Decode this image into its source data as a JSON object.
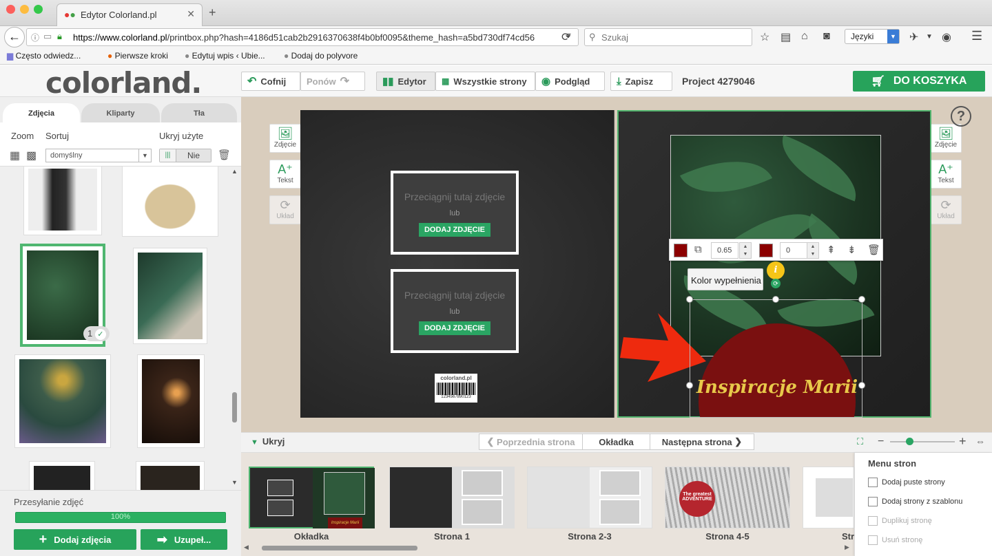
{
  "browser": {
    "tab_title": "Edytor Colorland.pl",
    "url_host": "https://www.colorland.pl",
    "url_path": "/printbox.php?hash=4186d51cab2b2916370638f4b0bf0095&theme_hash=a5bd730df74cd56",
    "search_placeholder": "Szukaj",
    "language": "Języki",
    "bookmarks": [
      "Często odwiedz...",
      "Pierwsze kroki",
      "Edytuj wpis ‹ Ubie...",
      "Dodaj do polyvore"
    ]
  },
  "app": {
    "logo": "colorland.",
    "undo": "Cofnij",
    "redo": "Ponów",
    "editor": "Edytor",
    "all_pages": "Wszystkie strony",
    "preview": "Podgląd",
    "save": "Zapisz",
    "project": "Project 4279046",
    "cart": "DO KOSZYKA"
  },
  "left": {
    "tabs": [
      "Zdjęcia",
      "Kliparty",
      "Tła"
    ],
    "zoom": "Zoom",
    "sort": "Sortuj",
    "hide_used": "Ukryj użyte",
    "sort_value": "domyślny",
    "hide_value": "Nie",
    "used_count": "1",
    "upload_label": "Przesyłanie zdjęć",
    "progress": "100%",
    "progress_value": 1.0,
    "add_photos": "Dodaj zdjęcia",
    "fill": "Uzupeł..."
  },
  "canvas": {
    "side_photos": "Zdjęcie",
    "side_text": "Tekst",
    "side_layout": "Układ",
    "drop_hint": "Przeciągnij tutaj zdjęcie",
    "drop_or": "lub",
    "drop_add": "DODAJ ZDJĘCIE",
    "barcode_brand": "colorland.pl",
    "barcode_number": "1234567890123",
    "circle_text": "Inspiracje Marii",
    "opacity_value": "0.65",
    "border_value": "0",
    "tooltip": "Kolor wypełnienia",
    "help": "?",
    "info": "i"
  },
  "pagenav": {
    "hide": "Ukryj",
    "prev": "Poprzednia strona",
    "current": "Okładka",
    "next": "Następna strona"
  },
  "thumbnails": {
    "labels": [
      "Okładka",
      "Strona 1",
      "Strona 2-3",
      "Strona 4-5",
      "Str"
    ],
    "cover_mini_text": "Inspiracje Marii",
    "page45_text": "The greatest ADVENTURE"
  },
  "pagemenu": {
    "title": "Menu stron",
    "items": [
      "Dodaj puste strony",
      "Dodaj strony z szablonu",
      "Duplikuj stronę",
      "Usuń stronę"
    ]
  },
  "colors": {
    "accent_green": "#27a35b",
    "fill_red": "#8b0000",
    "title_yellow": "#e8c94a"
  }
}
